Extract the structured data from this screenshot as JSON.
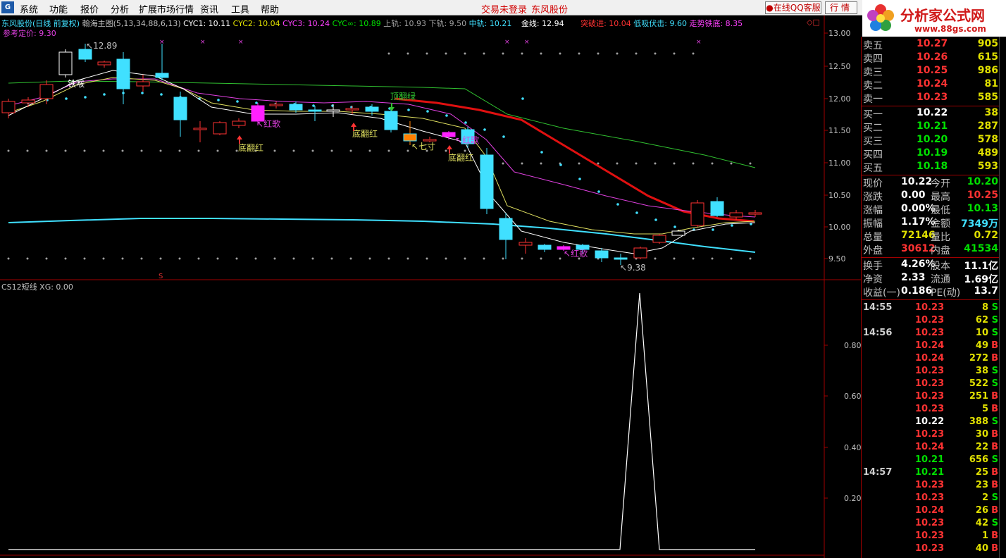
{
  "menubar": {
    "items": [
      "系统",
      "功能",
      "报价",
      "分析",
      "扩展市场行情",
      "资讯",
      "工具",
      "帮助"
    ],
    "login_status": "交易未登录",
    "stock_name": "东风股份",
    "qq_service": "在线QQ客服",
    "quote_button": "行情"
  },
  "watermark": {
    "brand": "分析家公式网",
    "url": "www.88gs.com"
  },
  "main_chart": {
    "header": {
      "title": "东风股份(日线 前复权)",
      "indicator": "翰海主图(5,13,34,88,6,13)",
      "cyc1": "CYC1: 10.11",
      "cyc2": "CYC2: 10.04",
      "cyc3": "CYC3: 10.24",
      "cycinf": "CYC∞: 10.89",
      "upper": "上轨: 10.93",
      "lower": "下轨: 9.50",
      "middle": "中轨: 10.21",
      "gold": "金线: 12.94",
      "breakout": "突破进: 10.04",
      "dip_buy": "低吸伏击: 9.60",
      "trend_bottom": "走势铁底: 8.35",
      "ref_price": "参考定价: 9.30"
    },
    "y_ticks": [
      "13.00",
      "12.50",
      "12.00",
      "11.50",
      "11.00",
      "10.50",
      "10.00",
      "9.50"
    ],
    "annotations": {
      "high": "12.89",
      "low": "9.38",
      "iron_throat": "铁喉",
      "red_song_1": "红歌",
      "red_song_2": "红歌",
      "red_song_3": "红歌",
      "bottom_red_1": "底翻红",
      "bottom_red_2": "底翻红",
      "bottom_red_3": "底翻红",
      "top_green": "顶翻绿",
      "seven_inch": "七寸",
      "s_marker": "S"
    }
  },
  "sub_chart": {
    "header": "CS12短线 XG: 0.00",
    "y_ticks": [
      "0.80",
      "0.60",
      "0.40",
      "0.20"
    ]
  },
  "quote": {
    "asks": [
      {
        "label": "卖五",
        "price": "10.27",
        "vol": "905"
      },
      {
        "label": "卖四",
        "price": "10.26",
        "vol": "615"
      },
      {
        "label": "卖三",
        "price": "10.25",
        "vol": "986"
      },
      {
        "label": "卖二",
        "price": "10.24",
        "vol": "81"
      },
      {
        "label": "卖一",
        "price": "10.23",
        "vol": "585"
      }
    ],
    "bids": [
      {
        "label": "买一",
        "price": "10.22",
        "vol": "38"
      },
      {
        "label": "买二",
        "price": "10.21",
        "vol": "287"
      },
      {
        "label": "买三",
        "price": "10.20",
        "vol": "578"
      },
      {
        "label": "买四",
        "price": "10.19",
        "vol": "489"
      },
      {
        "label": "买五",
        "price": "10.18",
        "vol": "593"
      }
    ],
    "stats": [
      {
        "l1": "现价",
        "v1": "10.22",
        "l2": "今开",
        "v2": "10.20"
      },
      {
        "l1": "涨跌",
        "v1": "0.00",
        "l2": "最高",
        "v2": "10.25"
      },
      {
        "l1": "涨幅",
        "v1": "0.00%",
        "l2": "最低",
        "v2": "10.13"
      },
      {
        "l1": "振幅",
        "v1": "1.17%",
        "l2": "金额",
        "v2": "7349万"
      },
      {
        "l1": "总量",
        "v1": "72146",
        "l2": "量比",
        "v2": "0.72"
      },
      {
        "l1": "外盘",
        "v1": "30612",
        "l2": "内盘",
        "v2": "41534"
      }
    ],
    "fin": [
      {
        "l1": "换手",
        "v1": "4.26%",
        "l2": "股本",
        "v2": "11.1亿"
      },
      {
        "l1": "净资",
        "v1": "2.33",
        "l2": "流通",
        "v2": "1.69亿"
      },
      {
        "l1": "收益(一)",
        "v1": "0.186",
        "l2": "PE(动)",
        "v2": "13.7"
      }
    ],
    "ticks": [
      {
        "time": "14:55",
        "price": "10.23",
        "vol": "8",
        "flag": "S",
        "pc": "red",
        "fc": "green"
      },
      {
        "time": "",
        "price": "10.23",
        "vol": "62",
        "flag": "S",
        "pc": "red",
        "fc": "green"
      },
      {
        "time": "14:56",
        "price": "10.23",
        "vol": "10",
        "flag": "S",
        "pc": "red",
        "fc": "green"
      },
      {
        "time": "",
        "price": "10.24",
        "vol": "49",
        "flag": "B",
        "pc": "red",
        "fc": "red"
      },
      {
        "time": "",
        "price": "10.24",
        "vol": "272",
        "flag": "B",
        "pc": "red",
        "fc": "red"
      },
      {
        "time": "",
        "price": "10.23",
        "vol": "38",
        "flag": "S",
        "pc": "red",
        "fc": "green"
      },
      {
        "time": "",
        "price": "10.23",
        "vol": "522",
        "flag": "S",
        "pc": "red",
        "fc": "green",
        "vc": "magenta"
      },
      {
        "time": "",
        "price": "10.23",
        "vol": "251",
        "flag": "B",
        "pc": "red",
        "fc": "red"
      },
      {
        "time": "",
        "price": "10.23",
        "vol": "5",
        "flag": "B",
        "pc": "red",
        "fc": "red"
      },
      {
        "time": "",
        "price": "10.22",
        "vol": "388",
        "flag": "S",
        "pc": "white",
        "fc": "green"
      },
      {
        "time": "",
        "price": "10.23",
        "vol": "30",
        "flag": "B",
        "pc": "red",
        "fc": "red"
      },
      {
        "time": "",
        "price": "10.24",
        "vol": "22",
        "flag": "B",
        "pc": "red",
        "fc": "red"
      },
      {
        "time": "",
        "price": "10.21",
        "vol": "656",
        "flag": "S",
        "pc": "green",
        "fc": "green",
        "vc": "magenta"
      },
      {
        "time": "14:57",
        "price": "10.21",
        "vol": "25",
        "flag": "B",
        "pc": "green",
        "fc": "red"
      },
      {
        "time": "",
        "price": "10.23",
        "vol": "23",
        "flag": "B",
        "pc": "red",
        "fc": "red"
      },
      {
        "time": "",
        "price": "10.23",
        "vol": "2",
        "flag": "S",
        "pc": "red",
        "fc": "green"
      },
      {
        "time": "",
        "price": "10.24",
        "vol": "26",
        "flag": "B",
        "pc": "red",
        "fc": "red"
      },
      {
        "time": "",
        "price": "10.23",
        "vol": "42",
        "flag": "S",
        "pc": "red",
        "fc": "green"
      },
      {
        "time": "",
        "price": "10.23",
        "vol": "1",
        "flag": "B",
        "pc": "red",
        "fc": "red"
      },
      {
        "time": "",
        "price": "10.23",
        "vol": "40",
        "flag": "B",
        "pc": "red",
        "fc": "red"
      }
    ]
  },
  "colors": {
    "up": "#ff3232",
    "down": "#40e0ff",
    "grid": "#a00000"
  }
}
